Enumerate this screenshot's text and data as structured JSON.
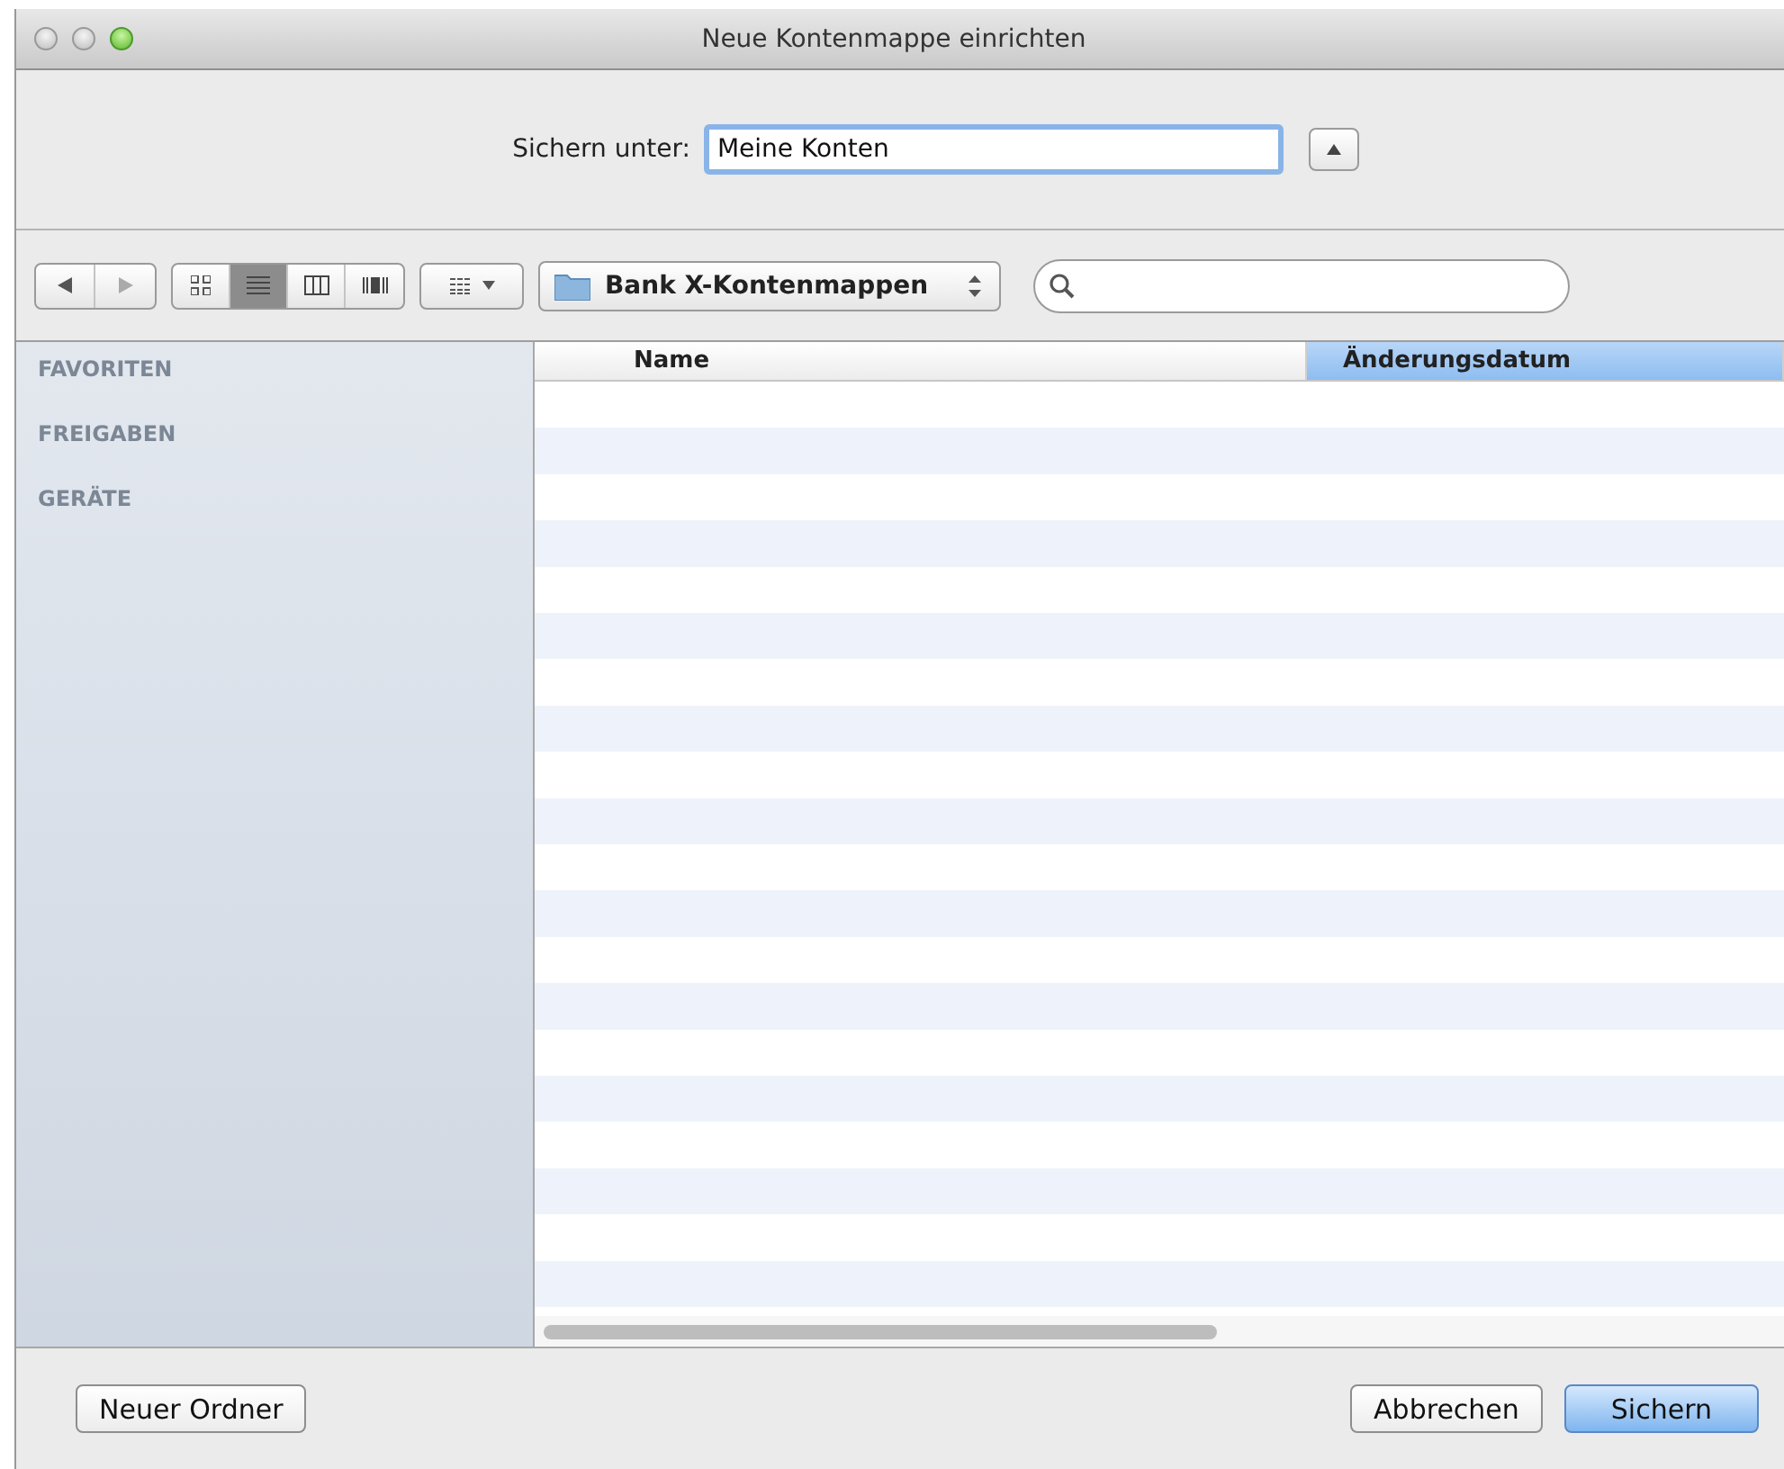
{
  "window": {
    "title": "Neue Kontenmappe einrichten"
  },
  "save_as": {
    "label": "Sichern unter:",
    "value": "Meine Konten",
    "expanded": true
  },
  "toolbar": {
    "view_modes": [
      {
        "kind": "icons",
        "selected": false
      },
      {
        "kind": "list",
        "selected": true
      },
      {
        "kind": "columns",
        "selected": false
      },
      {
        "kind": "coverflow",
        "selected": false
      }
    ],
    "location": "Bank X-Kontenmappen"
  },
  "sidebar": {
    "sections": [
      "FAVORITEN",
      "FREIGABEN",
      "GERÄTE"
    ]
  },
  "table": {
    "columns": [
      {
        "label": "Name",
        "selected": false
      },
      {
        "label": "Änderungsdatum",
        "selected": true
      }
    ]
  },
  "buttons": [
    {
      "label": "Neuer Ordner",
      "kind": "plain"
    },
    {
      "label": "Abbrechen",
      "kind": "plain"
    },
    {
      "label": "Sichern",
      "kind": "default"
    }
  ]
}
